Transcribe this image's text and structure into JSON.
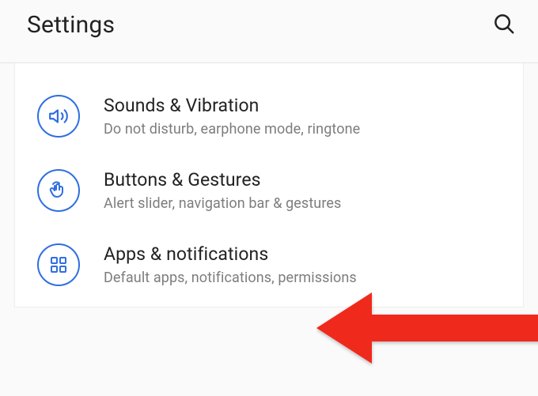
{
  "header": {
    "title": "Settings"
  },
  "items": [
    {
      "title": "Sounds & Vibration",
      "subtitle": "Do not disturb, earphone mode, ringtone"
    },
    {
      "title": "Buttons & Gestures",
      "subtitle": "Alert slider, navigation bar & gestures"
    },
    {
      "title": "Apps & notifications",
      "subtitle": "Default apps, notifications, permissions"
    }
  ]
}
